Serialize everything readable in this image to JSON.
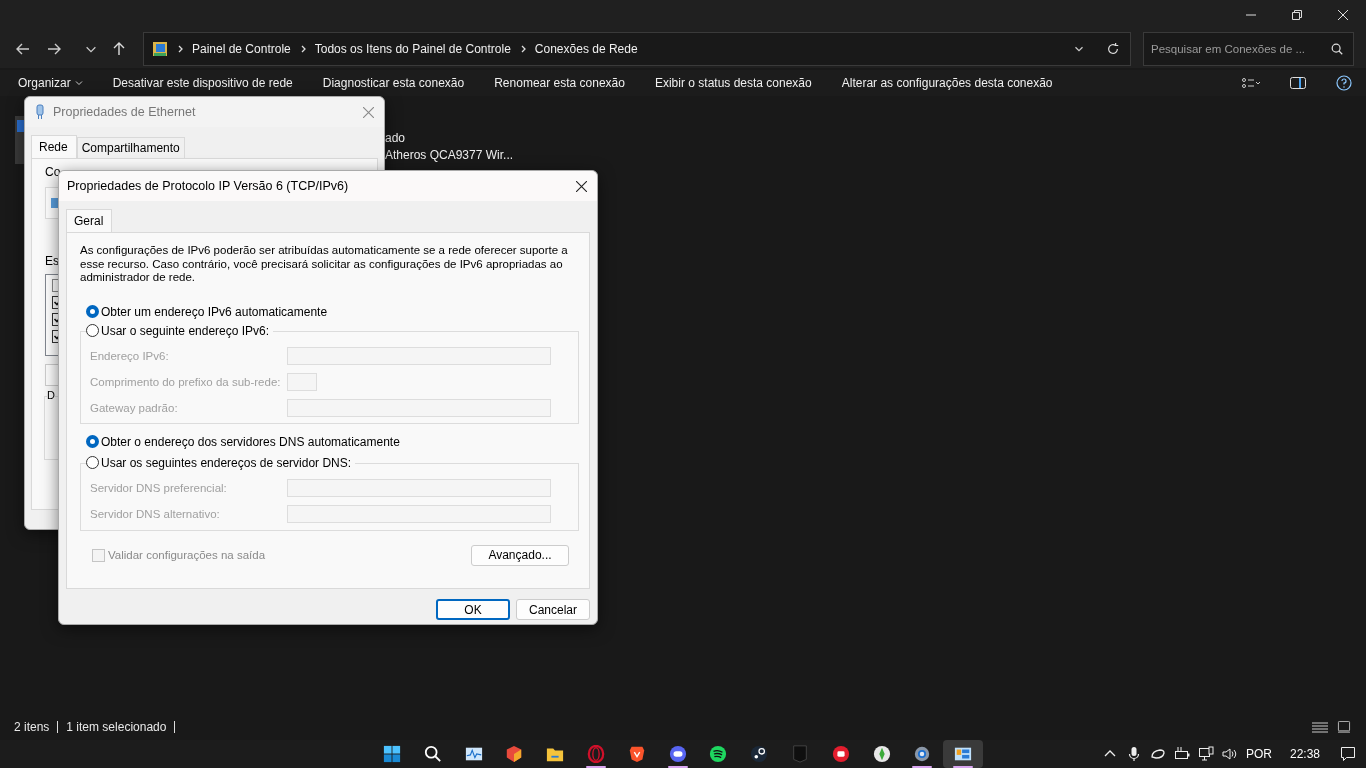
{
  "address_bar": {
    "crumbs": [
      "Painel de Controle",
      "Todos os Itens do Painel de Controle",
      "Conexões de Rede"
    ]
  },
  "search": {
    "placeholder": "Pesquisar em Conexões de ..."
  },
  "toolbar": {
    "items": [
      {
        "label": "Organizar",
        "kind": "menu"
      },
      {
        "label": "Desativar este dispositivo de rede",
        "kind": "command"
      },
      {
        "label": "Diagnosticar esta conexão",
        "kind": "command"
      },
      {
        "label": "Renomear esta conexão",
        "kind": "command"
      },
      {
        "label": "Exibir o status desta conexão",
        "kind": "command"
      },
      {
        "label": "Alterar as configurações desta conexão",
        "kind": "command"
      }
    ]
  },
  "items": [
    {
      "lines": [
        "ado",
        "Atheros QCA9377 Wir..."
      ],
      "selected": true
    }
  ],
  "status_bar": [
    "2 itens",
    "1 item selecionado"
  ],
  "ethernet_dialog": {
    "title": "Propriedades de Ethernet",
    "tabs": [
      {
        "label": "Rede",
        "selected": true
      },
      {
        "label": "Compartilhamento",
        "selected": false
      }
    ],
    "connect_label": "Co",
    "components_label": "Es",
    "components": [
      {
        "checked": false
      },
      {
        "checked": true
      },
      {
        "checked": true
      },
      {
        "checked": true
      }
    ],
    "group_label": "D"
  },
  "ipv6_dialog": {
    "title": "Propriedades de Protocolo IP Versão 6 (TCP/IPv6)",
    "tabs": [
      {
        "label": "Geral",
        "selected": true
      }
    ],
    "description": "As configurações de IPv6 poderão ser atribuídas automaticamente se a rede oferecer suporte a esse recurso. Caso contrário, você precisará solicitar as configurações de IPv6 apropriadas ao administrador de rede.",
    "address_options": [
      {
        "label": "Obter um endereço IPv6 automaticamente",
        "selected": true
      },
      {
        "label": "Usar o seguinte endereço IPv6:",
        "selected": false
      }
    ],
    "address_fields": [
      {
        "label": "Endereço IPv6:",
        "kind": "wide"
      },
      {
        "label": "Comprimento do prefixo da sub-rede:",
        "kind": "short"
      },
      {
        "label": "Gateway padrão:",
        "kind": "wide"
      }
    ],
    "dns_options": [
      {
        "label": "Obter o endereço dos servidores DNS automaticamente",
        "selected": true
      },
      {
        "label": "Usar os seguintes endereços de servidor DNS:",
        "selected": false
      }
    ],
    "dns_fields": [
      {
        "label": "Servidor DNS preferencial:",
        "kind": "wide"
      },
      {
        "label": "Servidor DNS alternativo:",
        "kind": "wide"
      }
    ],
    "validate": {
      "label": "Validar configurações na saída",
      "checked": false,
      "disabled": true
    },
    "advanced_button": "Avançado...",
    "buttons": [
      {
        "label": "OK",
        "kind": "default"
      },
      {
        "label": "Cancelar",
        "kind": "normal"
      }
    ]
  },
  "taskbar": {
    "apps": [
      {
        "kind": "start",
        "running": false,
        "selected": false
      },
      {
        "kind": "search",
        "running": false,
        "selected": false
      },
      {
        "kind": "monitor",
        "running": false,
        "selected": false
      },
      {
        "kind": "cube",
        "running": false,
        "selected": false
      },
      {
        "kind": "folder",
        "running": false,
        "selected": false
      },
      {
        "kind": "ring",
        "running": true,
        "selected": false
      },
      {
        "kind": "shield",
        "running": false,
        "selected": false
      },
      {
        "kind": "chat",
        "running": true,
        "selected": false
      },
      {
        "kind": "music",
        "running": false,
        "selected": false
      },
      {
        "kind": "steam",
        "running": false,
        "selected": false
      },
      {
        "kind": "dark",
        "running": false,
        "selected": false
      },
      {
        "kind": "fist",
        "running": false,
        "selected": false
      },
      {
        "kind": "gem",
        "running": false,
        "selected": false
      },
      {
        "kind": "gear",
        "running": true,
        "selected": false
      },
      {
        "kind": "panel",
        "running": true,
        "selected": true
      }
    ]
  },
  "tray": {
    "language": "POR",
    "time": "22:38"
  }
}
